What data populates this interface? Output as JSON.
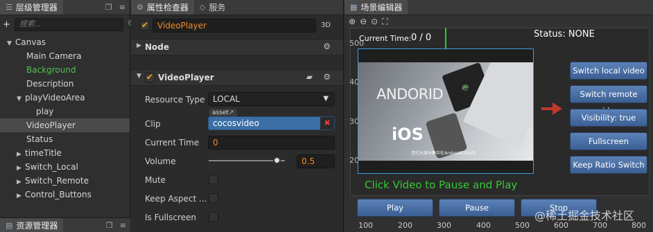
{
  "hierarchy": {
    "tab_label": "层级管理器",
    "search_placeholder": "搜索...",
    "nodes": [
      {
        "label": "Canvas"
      },
      {
        "label": "Main Camera"
      },
      {
        "label": "Background"
      },
      {
        "label": "Description"
      },
      {
        "label": "playVideoArea"
      },
      {
        "label": "play"
      },
      {
        "label": "VideoPlayer"
      },
      {
        "label": "Status"
      },
      {
        "label": "timeTitle"
      },
      {
        "label": "Switch_Local"
      },
      {
        "label": "Switch_Remote"
      },
      {
        "label": "Control_Buttons"
      }
    ]
  },
  "assets": {
    "tab_label": "资源管理器"
  },
  "inspector": {
    "tab_label": "属性检查器",
    "services_tab_label": "服务",
    "node_name": "VideoPlayer",
    "badge_3d": "3D",
    "node_section": "Node",
    "component_title": "VideoPlayer",
    "resource_type_label": "Resource Type",
    "resource_type_value": "LOCAL",
    "asset_tag": "asset",
    "clip_label": "Clip",
    "clip_value": "cocosvideo",
    "current_time_label": "Current Time",
    "current_time_value": "0",
    "volume_label": "Volume",
    "volume_value": "0.5",
    "volume_fraction": 0.5,
    "mute_label": "Mute",
    "keep_aspect_label": "Keep Aspect ...",
    "is_fullscreen_label": "Is Fullscreen"
  },
  "scene": {
    "tab_label": "场景编辑器",
    "current_time_caption": "Current Time:",
    "current_time_value": "0 / 0",
    "status_text": "Status: NONE",
    "video_text_android": "ANDORID",
    "video_text_ios": "iOS",
    "subtitle": "您们大部分集中在Android4.0以内",
    "click_hint": "Click Video to Pause and Play",
    "side_buttons": [
      "Switch local video",
      "Switch remote video",
      "Visibility: true",
      "Fullscreen",
      "Keep Ratio Switch"
    ],
    "bottom_buttons": [
      "Play",
      "Pause",
      "Stop"
    ],
    "y_ticks": [
      "500",
      "400",
      "300",
      "200"
    ],
    "x_ticks": [
      "100",
      "200",
      "300",
      "400",
      "500",
      "600",
      "700",
      "800"
    ],
    "watermark": "@稀土掘金技术社区"
  }
}
